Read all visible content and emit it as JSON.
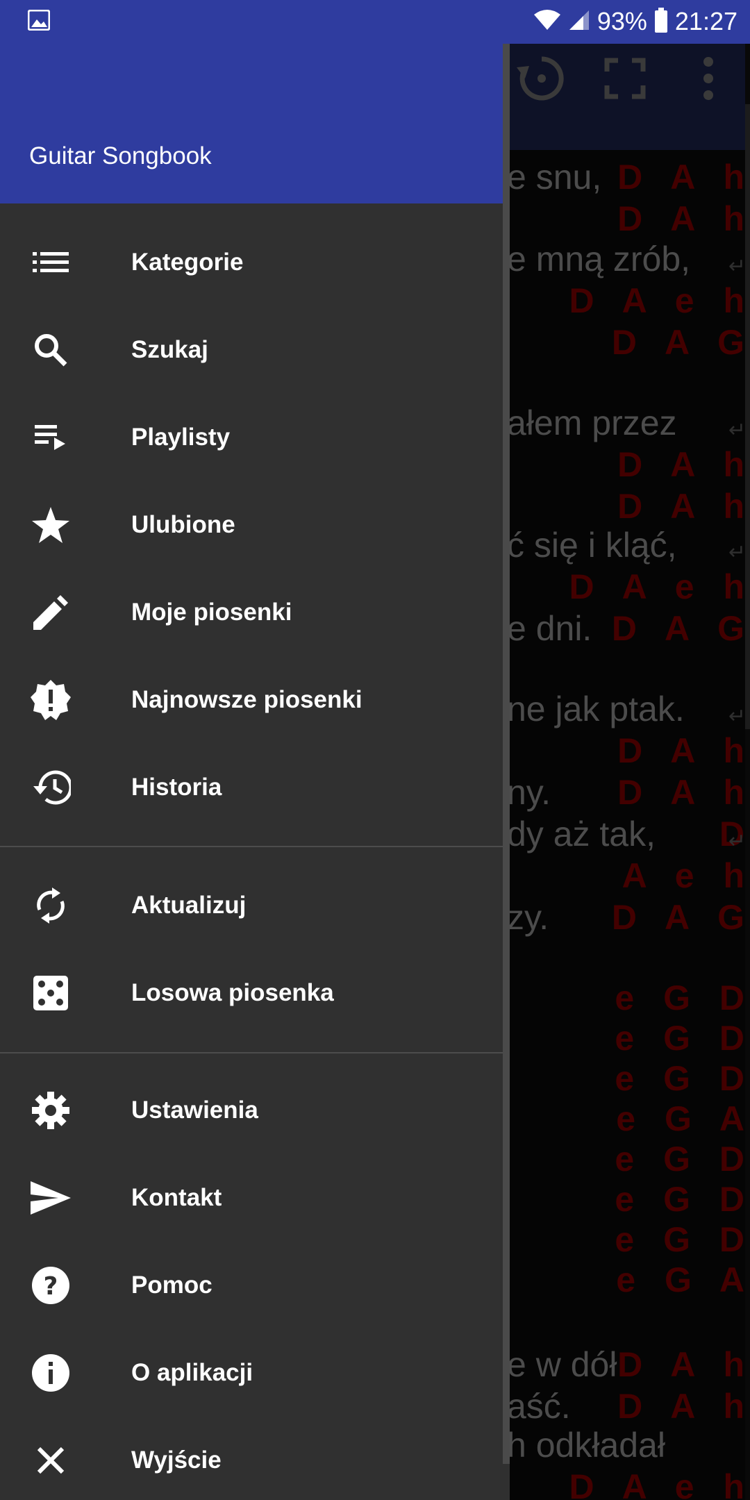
{
  "status_bar": {
    "battery": "93%",
    "time": "21:27"
  },
  "drawer": {
    "title": "Guitar Songbook",
    "group1": [
      {
        "label": "Kategorie",
        "icon": "list-icon"
      },
      {
        "label": "Szukaj",
        "icon": "search-icon"
      },
      {
        "label": "Playlisty",
        "icon": "playlist-icon"
      },
      {
        "label": "Ulubione",
        "icon": "star-icon"
      },
      {
        "label": "Moje piosenki",
        "icon": "pencil-icon"
      },
      {
        "label": "Najnowsze piosenki",
        "icon": "new-badge-icon"
      },
      {
        "label": "Historia",
        "icon": "history-icon"
      }
    ],
    "group2": [
      {
        "label": "Aktualizuj",
        "icon": "sync-icon"
      },
      {
        "label": "Losowa piosenka",
        "icon": "dice-icon"
      }
    ],
    "group3": [
      {
        "label": "Ustawienia",
        "icon": "gear-icon"
      },
      {
        "label": "Kontakt",
        "icon": "send-icon"
      },
      {
        "label": "Pomoc",
        "icon": "help-icon"
      },
      {
        "label": "O aplikacji",
        "icon": "info-icon"
      },
      {
        "label": "Wyjście",
        "icon": "close-icon"
      }
    ]
  },
  "song": {
    "lyrics": [
      "e snu,",
      "e mną zrób,",
      "ałem przez",
      "ć się i kląć,",
      "e dni.",
      "ne jak ptak.",
      "ny.",
      "dy aż tak,",
      "zy.",
      "e w dół",
      "aść.",
      "h odkładał"
    ],
    "chords": [
      "D A h",
      "D A h",
      "D A e h",
      "D A G",
      "D A h",
      "D A h",
      "D A e h",
      "D A G",
      "D A h",
      "D A h",
      "D",
      "A e h",
      "D A G",
      "e G D",
      "e G D",
      "e G D",
      "e G A",
      "e G D",
      "e G D",
      "e G D",
      "e G A",
      "D A h",
      "D A h",
      "D A e h"
    ]
  }
}
